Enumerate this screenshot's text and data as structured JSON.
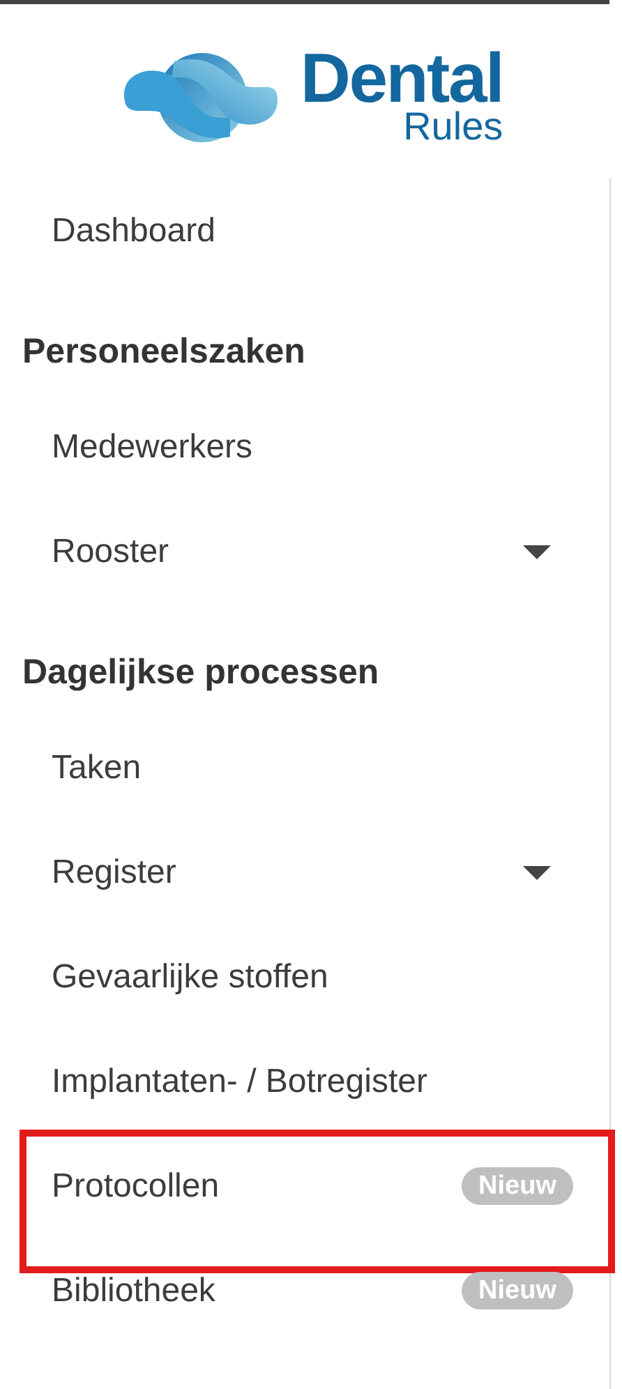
{
  "logo": {
    "title": "Dental",
    "subtitle": "Rules"
  },
  "nav": [
    {
      "kind": "item",
      "label": "Dashboard",
      "expandable": false,
      "highlighted": false
    },
    {
      "kind": "heading",
      "label": "Personeelszaken"
    },
    {
      "kind": "item",
      "label": "Medewerkers",
      "expandable": false,
      "highlighted": false
    },
    {
      "kind": "item",
      "label": "Rooster",
      "expandable": true,
      "highlighted": false
    },
    {
      "kind": "heading",
      "label": "Dagelijkse processen"
    },
    {
      "kind": "item",
      "label": "Taken",
      "expandable": false,
      "highlighted": false
    },
    {
      "kind": "item",
      "label": "Register",
      "expandable": true,
      "highlighted": false
    },
    {
      "kind": "item",
      "label": "Gevaarlijke stoffen",
      "expandable": false,
      "highlighted": false
    },
    {
      "kind": "item",
      "label": "Implantaten- / Botregister",
      "expandable": false,
      "highlighted": false
    },
    {
      "kind": "item",
      "label": "Protocollen",
      "expandable": false,
      "highlighted": true,
      "badge": "Nieuw"
    },
    {
      "kind": "item",
      "label": "Bibliotheek",
      "expandable": false,
      "highlighted": false,
      "badge": "Nieuw"
    }
  ]
}
